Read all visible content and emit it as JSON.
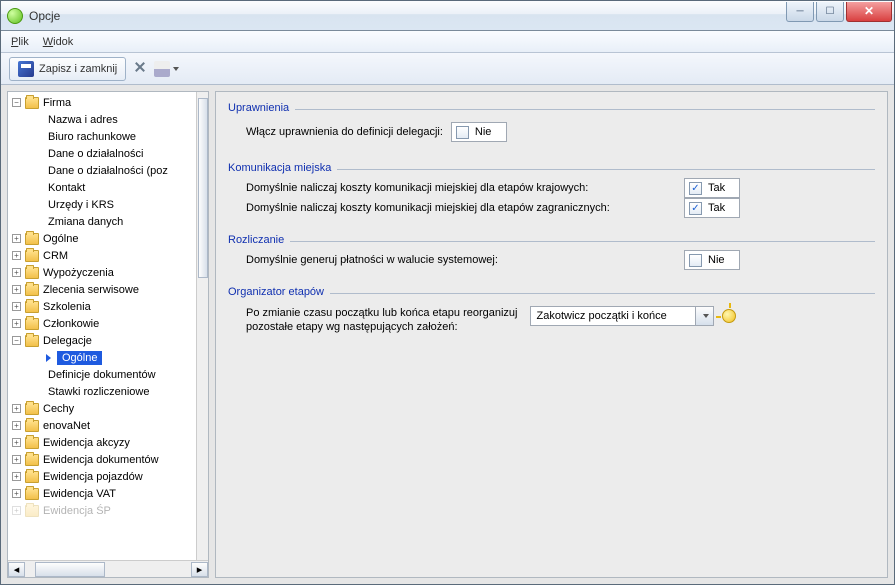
{
  "window": {
    "title": "Opcje"
  },
  "menu": {
    "file": "Plik",
    "view": "Widok"
  },
  "toolbar": {
    "save_close": "Zapisz i zamknij"
  },
  "tree": {
    "firma": "Firma",
    "firma_children": [
      "Nazwa i adres",
      "Biuro rachunkowe",
      "Dane o działalności",
      "Dane o działalności (poz",
      "Kontakt",
      "Urzędy i KRS",
      "Zmiana danych"
    ],
    "ogolne": "Ogólne",
    "crm": "CRM",
    "wypozyczenia": "Wypożyczenia",
    "zlecenia": "Zlecenia serwisowe",
    "szkolenia": "Szkolenia",
    "czlonkowie": "Członkowie",
    "delegacje": "Delegacje",
    "delegacje_children": {
      "ogolne": "Ogólne",
      "def_dok": "Definicje dokumentów",
      "stawki": "Stawki rozliczeniowe"
    },
    "cechy": "Cechy",
    "enovanet": "enovaNet",
    "ew_akcyzy": "Ewidencja akcyzy",
    "ew_dok": "Ewidencja dokumentów",
    "ew_poj": "Ewidencja pojazdów",
    "ew_vat": "Ewidencja VAT",
    "ew_sp": "Ewidencja ŚP"
  },
  "groups": {
    "uprawnienia": {
      "title": "Uprawnienia",
      "row1_label": "Włącz uprawnienia do definicji delegacji:",
      "row1_value": "Nie",
      "row1_checked": false
    },
    "komunikacja": {
      "title": "Komunikacja miejska",
      "row1_label": "Domyślnie naliczaj koszty komunikacji miejskiej dla etapów krajowych:",
      "row1_value": "Tak",
      "row1_checked": true,
      "row2_label": "Domyślnie naliczaj koszty komunikacji miejskiej dla etapów zagranicznych:",
      "row2_value": "Tak",
      "row2_checked": true
    },
    "rozliczanie": {
      "title": "Rozliczanie",
      "row1_label": "Domyślnie generuj płatności w walucie systemowej:",
      "row1_value": "Nie",
      "row1_checked": false
    },
    "organizator": {
      "title": "Organizator etapów",
      "row1_label_a": "Po zmianie czasu początku lub końca etapu reorganizuj",
      "row1_label_b": "pozostałe etapy wg następujących założeń:",
      "combo": "Zakotwicz początki i końce"
    }
  }
}
